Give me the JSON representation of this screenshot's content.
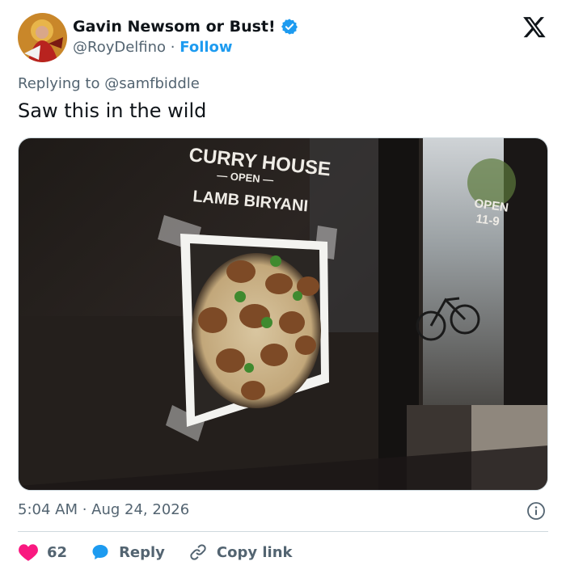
{
  "author": {
    "display_name": "Gavin Newsom or Bust!",
    "handle": "@RoyDelfino",
    "separator": "·",
    "follow_label": "Follow",
    "verified_color": "#1d9bf0"
  },
  "reply_to": "Replying to @samfbiddle",
  "tweet": {
    "text": "Saw this in the wild"
  },
  "photo_signage": {
    "line1": "CURRY HOUSE",
    "line2": "— OPEN —",
    "line3": "LAMB BIRYANI",
    "door_sign_1": "OPEN",
    "door_sign_2": "11-9"
  },
  "timestamp": "5:04 AM · Aug 24, 2026",
  "actions": {
    "like_count": "62",
    "reply_label": "Reply",
    "copy_link_label": "Copy link"
  },
  "icons": {
    "platform": "x-logo-icon",
    "verified": "verified-badge-icon",
    "info": "info-icon",
    "like": "heart-icon",
    "reply": "speech-bubble-icon",
    "copy": "link-icon"
  },
  "colors": {
    "like": "#f91880",
    "reply": "#1d9bf0",
    "link_blue": "#1d9bf0",
    "muted": "#536471"
  }
}
